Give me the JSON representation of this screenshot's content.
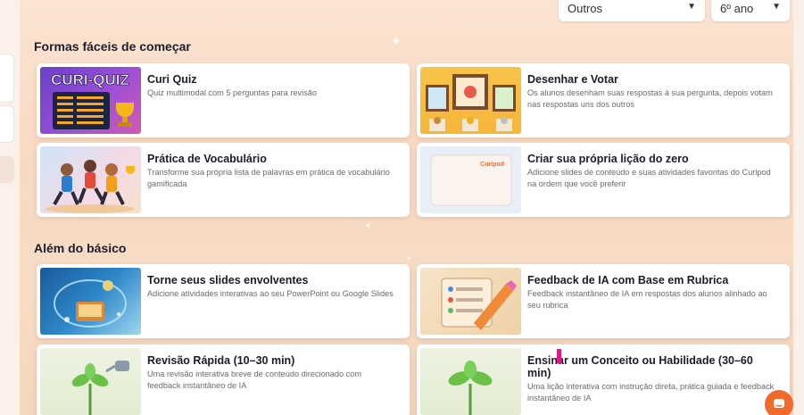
{
  "top_filters": {
    "subject": "Outros",
    "grade": "6º ano"
  },
  "sections": [
    {
      "title": "Formas fáceis de começar"
    },
    {
      "title": "Além do básico"
    }
  ],
  "cards": [
    {
      "title": "Curi Quiz",
      "description": "Quiz multimodal com 5 perguntas para revisão",
      "thumb_text": "CURI-QUIZ"
    },
    {
      "title": "Desenhar e Votar",
      "description": "Os alunos desenham suas respostas à sua pergunta, depois votam nas respostas uns dos outros"
    },
    {
      "title": "Prática de Vocabulário",
      "description": "Transforme sua própria lista de palavras em prática de vocabulário gamificada"
    },
    {
      "title": "Criar sua própria lição do zero",
      "description": "Adicione slides de conteúdo e suas atividades favoritas do Curipod na ordem que você preferir",
      "thumb_text": "Curipod"
    },
    {
      "title": "Torne seus slides envolventes",
      "description": "Adicione atividades interativas ao seu PowerPoint ou Google Slides"
    },
    {
      "title": "Feedback de IA com Base em Rubrica",
      "description": "Feedback instantâneo de IA em respostas dos alunos alinhado ao seu rubrica"
    },
    {
      "title": "Revisão Rápida (10–30 min)",
      "description": "Uma revisão interativa breve de conteúdo direcionado com feedback instantâneo de IA"
    },
    {
      "title": "Ensinar um Conceito ou Habilidade (30–60 min)",
      "description": "Uma lição interativa com instrução direta, prática guiada e feedback instantâneo de IA"
    }
  ],
  "colors": {
    "accent": "#f06a2b",
    "background": "#f9d9c2"
  },
  "icons": {
    "chat_button": "chat-icon"
  }
}
